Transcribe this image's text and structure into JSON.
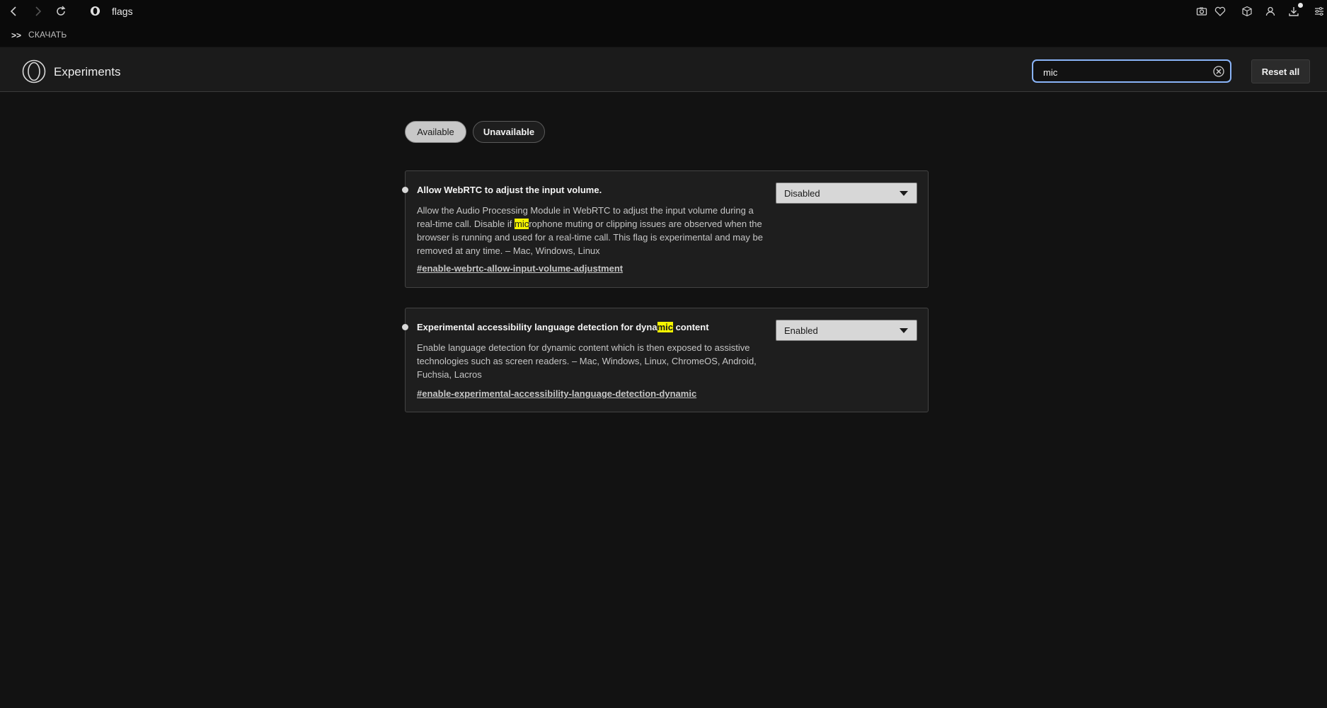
{
  "toolbar": {
    "url": "flags",
    "icons": [
      "back-icon",
      "forward-icon",
      "reload-icon",
      "opera-icon",
      "camera-icon",
      "heart-icon",
      "cube-icon",
      "profile-icon",
      "download-icon",
      "easy-setup-icon"
    ]
  },
  "bookmarks": {
    "chevron": ">>",
    "item": "СКАЧАТЬ"
  },
  "header": {
    "title": "Experiments",
    "search_value": "mic",
    "reset_label": "Reset all"
  },
  "tabs": {
    "available": "Available",
    "unavailable": "Unavailable"
  },
  "flags": [
    {
      "title": "Allow WebRTC to adjust the input volume.",
      "desc_before": "Allow the Audio Processing Module in WebRTC to adjust the input volume during a real-time call. Disable if ",
      "desc_highlight": "mic",
      "desc_after": "rophone muting or clipping issues are observed when the browser is running and used for a real-time call. This flag is experimental and may be removed at any time. – Mac, Windows, Linux",
      "link": "#enable-webrtc-allow-input-volume-adjustment",
      "state": "Disabled"
    },
    {
      "title_before": "Experimental accessibility language detection for dyna",
      "title_highlight": "mic",
      "title_after": " content",
      "desc": "Enable language detection for dynamic content which is then exposed to assistive technologies such as screen readers. – Mac, Windows, Linux, ChromeOS, Android, Fuchsia, Lacros",
      "link": "#enable-experimental-accessibility-language-detection-dynamic",
      "state": "Enabled"
    }
  ],
  "colors": {
    "highlight": "#f5f500",
    "search_border": "#8ab4f8"
  }
}
